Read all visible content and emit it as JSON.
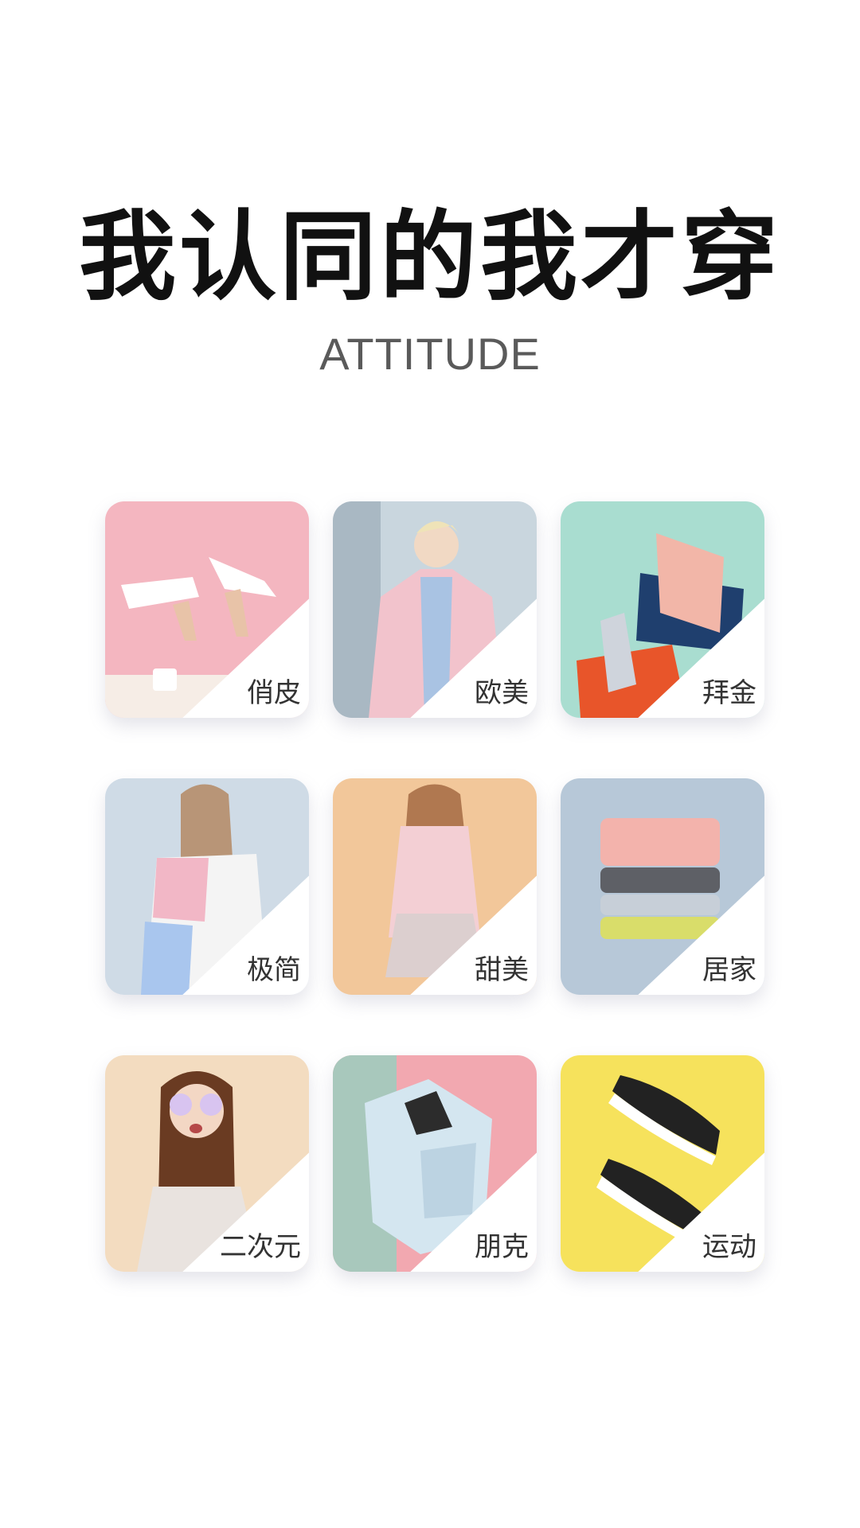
{
  "header": {
    "title": "我认同的我才穿",
    "subtitle": "ATTITUDE"
  },
  "styles": [
    {
      "label": "俏皮",
      "bg": "#f4b6c0",
      "image": "sneakers-on-pink"
    },
    {
      "label": "欧美",
      "bg": "#c9d6de",
      "image": "blonde-woman-pink-coat"
    },
    {
      "label": "拜金",
      "bg": "#a9ddd0",
      "image": "pink-handbag-silver-heel"
    },
    {
      "label": "极简",
      "bg": "#cfdbe6",
      "image": "woman-pastel-jacket-back"
    },
    {
      "label": "甜美",
      "bg": "#f2c79a",
      "image": "woman-pink-cardigan"
    },
    {
      "label": "居家",
      "bg": "#b7c8d8",
      "image": "folded-sweaters-stack"
    },
    {
      "label": "二次元",
      "bg": "#f3dcc0",
      "image": "girl-round-sunglasses"
    },
    {
      "label": "朋克",
      "bg": "#f2a8b0",
      "image": "light-blue-leather-jacket"
    },
    {
      "label": "运动",
      "bg": "#f6e25c",
      "image": "black-sneakers-on-yellow"
    }
  ]
}
